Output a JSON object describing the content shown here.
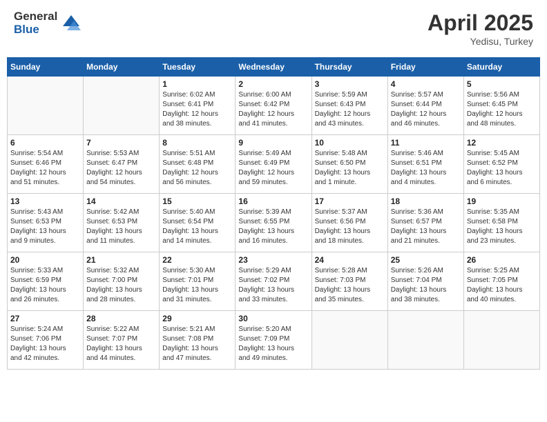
{
  "header": {
    "logo_general": "General",
    "logo_blue": "Blue",
    "title": "April 2025",
    "location": "Yedisu, Turkey"
  },
  "weekdays": [
    "Sunday",
    "Monday",
    "Tuesday",
    "Wednesday",
    "Thursday",
    "Friday",
    "Saturday"
  ],
  "weeks": [
    [
      {
        "day": "",
        "info": ""
      },
      {
        "day": "",
        "info": ""
      },
      {
        "day": "1",
        "info": "Sunrise: 6:02 AM\nSunset: 6:41 PM\nDaylight: 12 hours\nand 38 minutes."
      },
      {
        "day": "2",
        "info": "Sunrise: 6:00 AM\nSunset: 6:42 PM\nDaylight: 12 hours\nand 41 minutes."
      },
      {
        "day": "3",
        "info": "Sunrise: 5:59 AM\nSunset: 6:43 PM\nDaylight: 12 hours\nand 43 minutes."
      },
      {
        "day": "4",
        "info": "Sunrise: 5:57 AM\nSunset: 6:44 PM\nDaylight: 12 hours\nand 46 minutes."
      },
      {
        "day": "5",
        "info": "Sunrise: 5:56 AM\nSunset: 6:45 PM\nDaylight: 12 hours\nand 48 minutes."
      }
    ],
    [
      {
        "day": "6",
        "info": "Sunrise: 5:54 AM\nSunset: 6:46 PM\nDaylight: 12 hours\nand 51 minutes."
      },
      {
        "day": "7",
        "info": "Sunrise: 5:53 AM\nSunset: 6:47 PM\nDaylight: 12 hours\nand 54 minutes."
      },
      {
        "day": "8",
        "info": "Sunrise: 5:51 AM\nSunset: 6:48 PM\nDaylight: 12 hours\nand 56 minutes."
      },
      {
        "day": "9",
        "info": "Sunrise: 5:49 AM\nSunset: 6:49 PM\nDaylight: 12 hours\nand 59 minutes."
      },
      {
        "day": "10",
        "info": "Sunrise: 5:48 AM\nSunset: 6:50 PM\nDaylight: 13 hours\nand 1 minute."
      },
      {
        "day": "11",
        "info": "Sunrise: 5:46 AM\nSunset: 6:51 PM\nDaylight: 13 hours\nand 4 minutes."
      },
      {
        "day": "12",
        "info": "Sunrise: 5:45 AM\nSunset: 6:52 PM\nDaylight: 13 hours\nand 6 minutes."
      }
    ],
    [
      {
        "day": "13",
        "info": "Sunrise: 5:43 AM\nSunset: 6:53 PM\nDaylight: 13 hours\nand 9 minutes."
      },
      {
        "day": "14",
        "info": "Sunrise: 5:42 AM\nSunset: 6:53 PM\nDaylight: 13 hours\nand 11 minutes."
      },
      {
        "day": "15",
        "info": "Sunrise: 5:40 AM\nSunset: 6:54 PM\nDaylight: 13 hours\nand 14 minutes."
      },
      {
        "day": "16",
        "info": "Sunrise: 5:39 AM\nSunset: 6:55 PM\nDaylight: 13 hours\nand 16 minutes."
      },
      {
        "day": "17",
        "info": "Sunrise: 5:37 AM\nSunset: 6:56 PM\nDaylight: 13 hours\nand 18 minutes."
      },
      {
        "day": "18",
        "info": "Sunrise: 5:36 AM\nSunset: 6:57 PM\nDaylight: 13 hours\nand 21 minutes."
      },
      {
        "day": "19",
        "info": "Sunrise: 5:35 AM\nSunset: 6:58 PM\nDaylight: 13 hours\nand 23 minutes."
      }
    ],
    [
      {
        "day": "20",
        "info": "Sunrise: 5:33 AM\nSunset: 6:59 PM\nDaylight: 13 hours\nand 26 minutes."
      },
      {
        "day": "21",
        "info": "Sunrise: 5:32 AM\nSunset: 7:00 PM\nDaylight: 13 hours\nand 28 minutes."
      },
      {
        "day": "22",
        "info": "Sunrise: 5:30 AM\nSunset: 7:01 PM\nDaylight: 13 hours\nand 31 minutes."
      },
      {
        "day": "23",
        "info": "Sunrise: 5:29 AM\nSunset: 7:02 PM\nDaylight: 13 hours\nand 33 minutes."
      },
      {
        "day": "24",
        "info": "Sunrise: 5:28 AM\nSunset: 7:03 PM\nDaylight: 13 hours\nand 35 minutes."
      },
      {
        "day": "25",
        "info": "Sunrise: 5:26 AM\nSunset: 7:04 PM\nDaylight: 13 hours\nand 38 minutes."
      },
      {
        "day": "26",
        "info": "Sunrise: 5:25 AM\nSunset: 7:05 PM\nDaylight: 13 hours\nand 40 minutes."
      }
    ],
    [
      {
        "day": "27",
        "info": "Sunrise: 5:24 AM\nSunset: 7:06 PM\nDaylight: 13 hours\nand 42 minutes."
      },
      {
        "day": "28",
        "info": "Sunrise: 5:22 AM\nSunset: 7:07 PM\nDaylight: 13 hours\nand 44 minutes."
      },
      {
        "day": "29",
        "info": "Sunrise: 5:21 AM\nSunset: 7:08 PM\nDaylight: 13 hours\nand 47 minutes."
      },
      {
        "day": "30",
        "info": "Sunrise: 5:20 AM\nSunset: 7:09 PM\nDaylight: 13 hours\nand 49 minutes."
      },
      {
        "day": "",
        "info": ""
      },
      {
        "day": "",
        "info": ""
      },
      {
        "day": "",
        "info": ""
      }
    ]
  ]
}
